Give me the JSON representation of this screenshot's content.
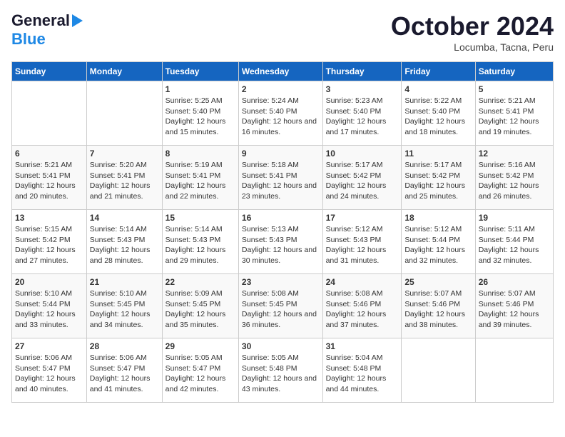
{
  "logo": {
    "line1": "General",
    "line2": "Blue"
  },
  "header": {
    "month": "October 2024",
    "location": "Locumba, Tacna, Peru"
  },
  "weekdays": [
    "Sunday",
    "Monday",
    "Tuesday",
    "Wednesday",
    "Thursday",
    "Friday",
    "Saturday"
  ],
  "weeks": [
    [
      {
        "day": "",
        "detail": ""
      },
      {
        "day": "",
        "detail": ""
      },
      {
        "day": "1",
        "detail": "Sunrise: 5:25 AM\nSunset: 5:40 PM\nDaylight: 12 hours and 15 minutes."
      },
      {
        "day": "2",
        "detail": "Sunrise: 5:24 AM\nSunset: 5:40 PM\nDaylight: 12 hours and 16 minutes."
      },
      {
        "day": "3",
        "detail": "Sunrise: 5:23 AM\nSunset: 5:40 PM\nDaylight: 12 hours and 17 minutes."
      },
      {
        "day": "4",
        "detail": "Sunrise: 5:22 AM\nSunset: 5:40 PM\nDaylight: 12 hours and 18 minutes."
      },
      {
        "day": "5",
        "detail": "Sunrise: 5:21 AM\nSunset: 5:41 PM\nDaylight: 12 hours and 19 minutes."
      }
    ],
    [
      {
        "day": "6",
        "detail": "Sunrise: 5:21 AM\nSunset: 5:41 PM\nDaylight: 12 hours and 20 minutes."
      },
      {
        "day": "7",
        "detail": "Sunrise: 5:20 AM\nSunset: 5:41 PM\nDaylight: 12 hours and 21 minutes."
      },
      {
        "day": "8",
        "detail": "Sunrise: 5:19 AM\nSunset: 5:41 PM\nDaylight: 12 hours and 22 minutes."
      },
      {
        "day": "9",
        "detail": "Sunrise: 5:18 AM\nSunset: 5:41 PM\nDaylight: 12 hours and 23 minutes."
      },
      {
        "day": "10",
        "detail": "Sunrise: 5:17 AM\nSunset: 5:42 PM\nDaylight: 12 hours and 24 minutes."
      },
      {
        "day": "11",
        "detail": "Sunrise: 5:17 AM\nSunset: 5:42 PM\nDaylight: 12 hours and 25 minutes."
      },
      {
        "day": "12",
        "detail": "Sunrise: 5:16 AM\nSunset: 5:42 PM\nDaylight: 12 hours and 26 minutes."
      }
    ],
    [
      {
        "day": "13",
        "detail": "Sunrise: 5:15 AM\nSunset: 5:42 PM\nDaylight: 12 hours and 27 minutes."
      },
      {
        "day": "14",
        "detail": "Sunrise: 5:14 AM\nSunset: 5:43 PM\nDaylight: 12 hours and 28 minutes."
      },
      {
        "day": "15",
        "detail": "Sunrise: 5:14 AM\nSunset: 5:43 PM\nDaylight: 12 hours and 29 minutes."
      },
      {
        "day": "16",
        "detail": "Sunrise: 5:13 AM\nSunset: 5:43 PM\nDaylight: 12 hours and 30 minutes."
      },
      {
        "day": "17",
        "detail": "Sunrise: 5:12 AM\nSunset: 5:43 PM\nDaylight: 12 hours and 31 minutes."
      },
      {
        "day": "18",
        "detail": "Sunrise: 5:12 AM\nSunset: 5:44 PM\nDaylight: 12 hours and 32 minutes."
      },
      {
        "day": "19",
        "detail": "Sunrise: 5:11 AM\nSunset: 5:44 PM\nDaylight: 12 hours and 32 minutes."
      }
    ],
    [
      {
        "day": "20",
        "detail": "Sunrise: 5:10 AM\nSunset: 5:44 PM\nDaylight: 12 hours and 33 minutes."
      },
      {
        "day": "21",
        "detail": "Sunrise: 5:10 AM\nSunset: 5:45 PM\nDaylight: 12 hours and 34 minutes."
      },
      {
        "day": "22",
        "detail": "Sunrise: 5:09 AM\nSunset: 5:45 PM\nDaylight: 12 hours and 35 minutes."
      },
      {
        "day": "23",
        "detail": "Sunrise: 5:08 AM\nSunset: 5:45 PM\nDaylight: 12 hours and 36 minutes."
      },
      {
        "day": "24",
        "detail": "Sunrise: 5:08 AM\nSunset: 5:46 PM\nDaylight: 12 hours and 37 minutes."
      },
      {
        "day": "25",
        "detail": "Sunrise: 5:07 AM\nSunset: 5:46 PM\nDaylight: 12 hours and 38 minutes."
      },
      {
        "day": "26",
        "detail": "Sunrise: 5:07 AM\nSunset: 5:46 PM\nDaylight: 12 hours and 39 minutes."
      }
    ],
    [
      {
        "day": "27",
        "detail": "Sunrise: 5:06 AM\nSunset: 5:47 PM\nDaylight: 12 hours and 40 minutes."
      },
      {
        "day": "28",
        "detail": "Sunrise: 5:06 AM\nSunset: 5:47 PM\nDaylight: 12 hours and 41 minutes."
      },
      {
        "day": "29",
        "detail": "Sunrise: 5:05 AM\nSunset: 5:47 PM\nDaylight: 12 hours and 42 minutes."
      },
      {
        "day": "30",
        "detail": "Sunrise: 5:05 AM\nSunset: 5:48 PM\nDaylight: 12 hours and 43 minutes."
      },
      {
        "day": "31",
        "detail": "Sunrise: 5:04 AM\nSunset: 5:48 PM\nDaylight: 12 hours and 44 minutes."
      },
      {
        "day": "",
        "detail": ""
      },
      {
        "day": "",
        "detail": ""
      }
    ]
  ]
}
